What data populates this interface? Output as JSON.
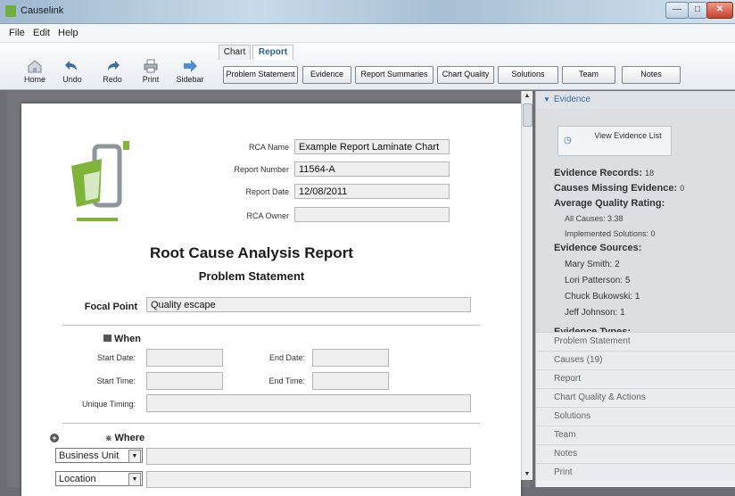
{
  "window": {
    "title": "Causelink"
  },
  "menu": {
    "file": "File",
    "edit": "Edit",
    "help": "Help"
  },
  "toolbar": {
    "home": "Home",
    "undo": "Undo",
    "redo": "Redo",
    "print": "Print",
    "sidebar": "Sidebar"
  },
  "tabs": {
    "chart": "Chart",
    "report": "Report"
  },
  "subtabs": [
    "Problem Statement",
    "Evidence",
    "Report Summaries",
    "Chart Quality",
    "Solutions",
    "Team",
    "Notes"
  ],
  "report": {
    "rca_name_label": "RCA Name",
    "rca_name": "Example Report Laminate Chart",
    "report_number_label": "Report Number",
    "report_number": "11564-A",
    "report_date_label": "Report Date",
    "report_date": "12/08/2011",
    "rca_owner_label": "RCA Owner",
    "rca_owner": "",
    "title": "Root Cause Analysis Report",
    "section": "Problem Statement",
    "focal_point_label": "Focal Point",
    "focal_point": "Quality escape",
    "when_label": "When",
    "start_date_label": "Start Date:",
    "end_date_label": "End Date:",
    "start_time_label": "Start Time:",
    "end_time_label": "End Time:",
    "unique_timing_label": "Unique Timing:",
    "where_label": "Where",
    "business_unit": "Business Unit",
    "location": "Location"
  },
  "sidebar": {
    "header": "Evidence",
    "view_evidence": "View Evidence List",
    "evidence_records_label": "Evidence Records:",
    "evidence_records": "18",
    "causes_missing_label": "Causes Missing Evidence:",
    "causes_missing": "0",
    "avg_quality_label": "Average Quality Rating:",
    "all_causes": "All Causes: 3.38",
    "implemented_solutions": "Implemented Solutions: 0",
    "sources_label": "Evidence Sources:",
    "sources": [
      "Mary Smith: 2",
      "Lori Patterson: 5",
      "Chuck Bukowski: 1",
      "Jeff Johnson: 1"
    ],
    "types_label": "Evidence Types:",
    "sections": [
      "Problem Statement",
      "Causes (19)",
      "Report",
      "Chart Quality & Actions",
      "Solutions",
      "Team",
      "Notes",
      "Print"
    ]
  },
  "colors": {
    "accent": "#3a6ea5",
    "logo_green": "#7fb33a",
    "logo_gray": "#9aa0a6"
  }
}
